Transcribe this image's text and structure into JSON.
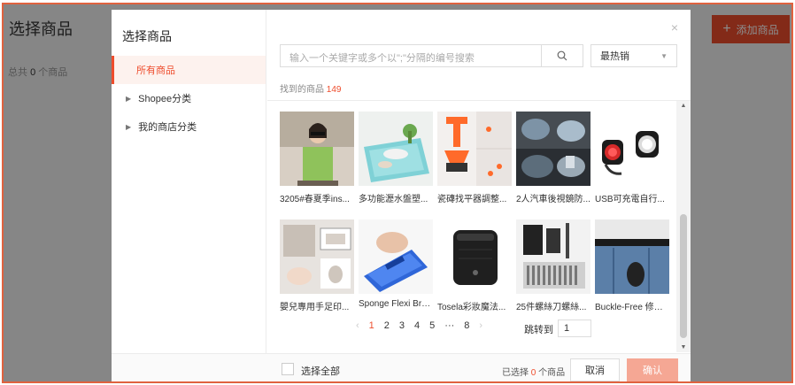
{
  "page": {
    "title": "选择商品",
    "count_prefix": "总共",
    "count_value": "0",
    "count_suffix": "个商品",
    "add_button": "添加商品"
  },
  "modal": {
    "title": "选择商品",
    "close": "×",
    "categories": [
      {
        "label": "所有商品",
        "active": true,
        "expandable": false
      },
      {
        "label": "Shopee分类",
        "active": false,
        "expandable": true
      },
      {
        "label": "我的商店分类",
        "active": false,
        "expandable": true
      }
    ],
    "search": {
      "placeholder": "输入一个关键字或多个以\";\"分隔的编号搜索"
    },
    "sort": {
      "selected": "最热销"
    },
    "found": {
      "label": "找到的商品",
      "count": "149"
    },
    "products": [
      {
        "name": "3205#春夏季ins...",
        "icon": "shirt-photo"
      },
      {
        "name": "多功能瀝水盤塑...",
        "icon": "drain-tray-photo"
      },
      {
        "name": "瓷磚找平器調整...",
        "icon": "tile-leveler-photo"
      },
      {
        "name": "2人汽車後視鏡防...",
        "icon": "car-mirror-photo"
      },
      {
        "name": "USB可充電自行...",
        "icon": "bike-light-photo"
      },
      {
        "name": "嬰兒專用手足印...",
        "icon": "baby-print-photo"
      },
      {
        "name": "Sponge Flexi Bru...",
        "icon": "sponge-brush-photo"
      },
      {
        "name": "Tosela彩妝魔法...",
        "icon": "makeup-box-photo"
      },
      {
        "name": "25件螺絲刀螺絲...",
        "icon": "screwdriver-set-photo"
      },
      {
        "name": "Buckle-Free 修身...",
        "icon": "belt-photo"
      }
    ],
    "pagination": {
      "prev": "‹",
      "pages": [
        "1",
        "2",
        "3",
        "4",
        "5",
        "···",
        "8"
      ],
      "current": "1",
      "next": "›",
      "jump_label": "跳转到",
      "jump_value": "1"
    },
    "footer": {
      "select_all": "选择全部",
      "selected_prefix": "已选择",
      "selected_count": "0",
      "selected_suffix": "个商品",
      "cancel": "取消",
      "confirm": "确认"
    },
    "colors": {
      "accent": "#ee4d2d",
      "confirm_disabled": "#f5a794"
    }
  }
}
